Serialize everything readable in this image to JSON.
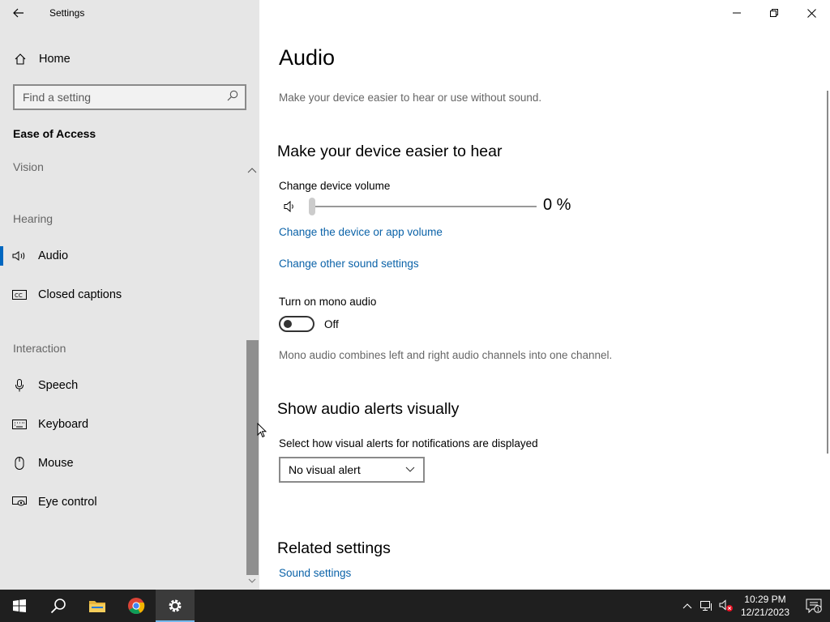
{
  "window": {
    "title": "Settings"
  },
  "sidebar": {
    "home_label": "Home",
    "search_placeholder": "Find a setting",
    "section": "Ease of Access",
    "groups": {
      "vision": "Vision",
      "hearing": "Hearing",
      "interaction": "Interaction"
    },
    "items": {
      "audio": "Audio",
      "closed_captions": "Closed captions",
      "speech": "Speech",
      "keyboard": "Keyboard",
      "mouse": "Mouse",
      "eye_control": "Eye control"
    }
  },
  "main": {
    "title": "Audio",
    "subtitle": "Make your device easier to hear or use without sound.",
    "hear_section": {
      "heading": "Make your device easier to hear",
      "volume_label": "Change device volume",
      "volume_value": 0,
      "volume_display": "0 %",
      "link_device_volume": "Change the device or app volume",
      "link_other_sound": "Change other sound settings",
      "mono_label": "Turn on mono audio",
      "mono_state": "Off",
      "mono_description": "Mono audio combines left and right audio channels into one channel."
    },
    "alerts_section": {
      "heading": "Show audio alerts visually",
      "select_label": "Select how visual alerts for notifications are displayed",
      "selected_value": "No visual alert"
    },
    "related": {
      "heading": "Related settings",
      "link_sound_settings": "Sound settings"
    }
  },
  "taskbar": {
    "time": "10:29 PM",
    "date": "12/21/2023",
    "notification_count": "1"
  },
  "colors": {
    "accent": "#0067c0",
    "link": "#0a62a8",
    "taskbar": "#1f1f1f"
  }
}
